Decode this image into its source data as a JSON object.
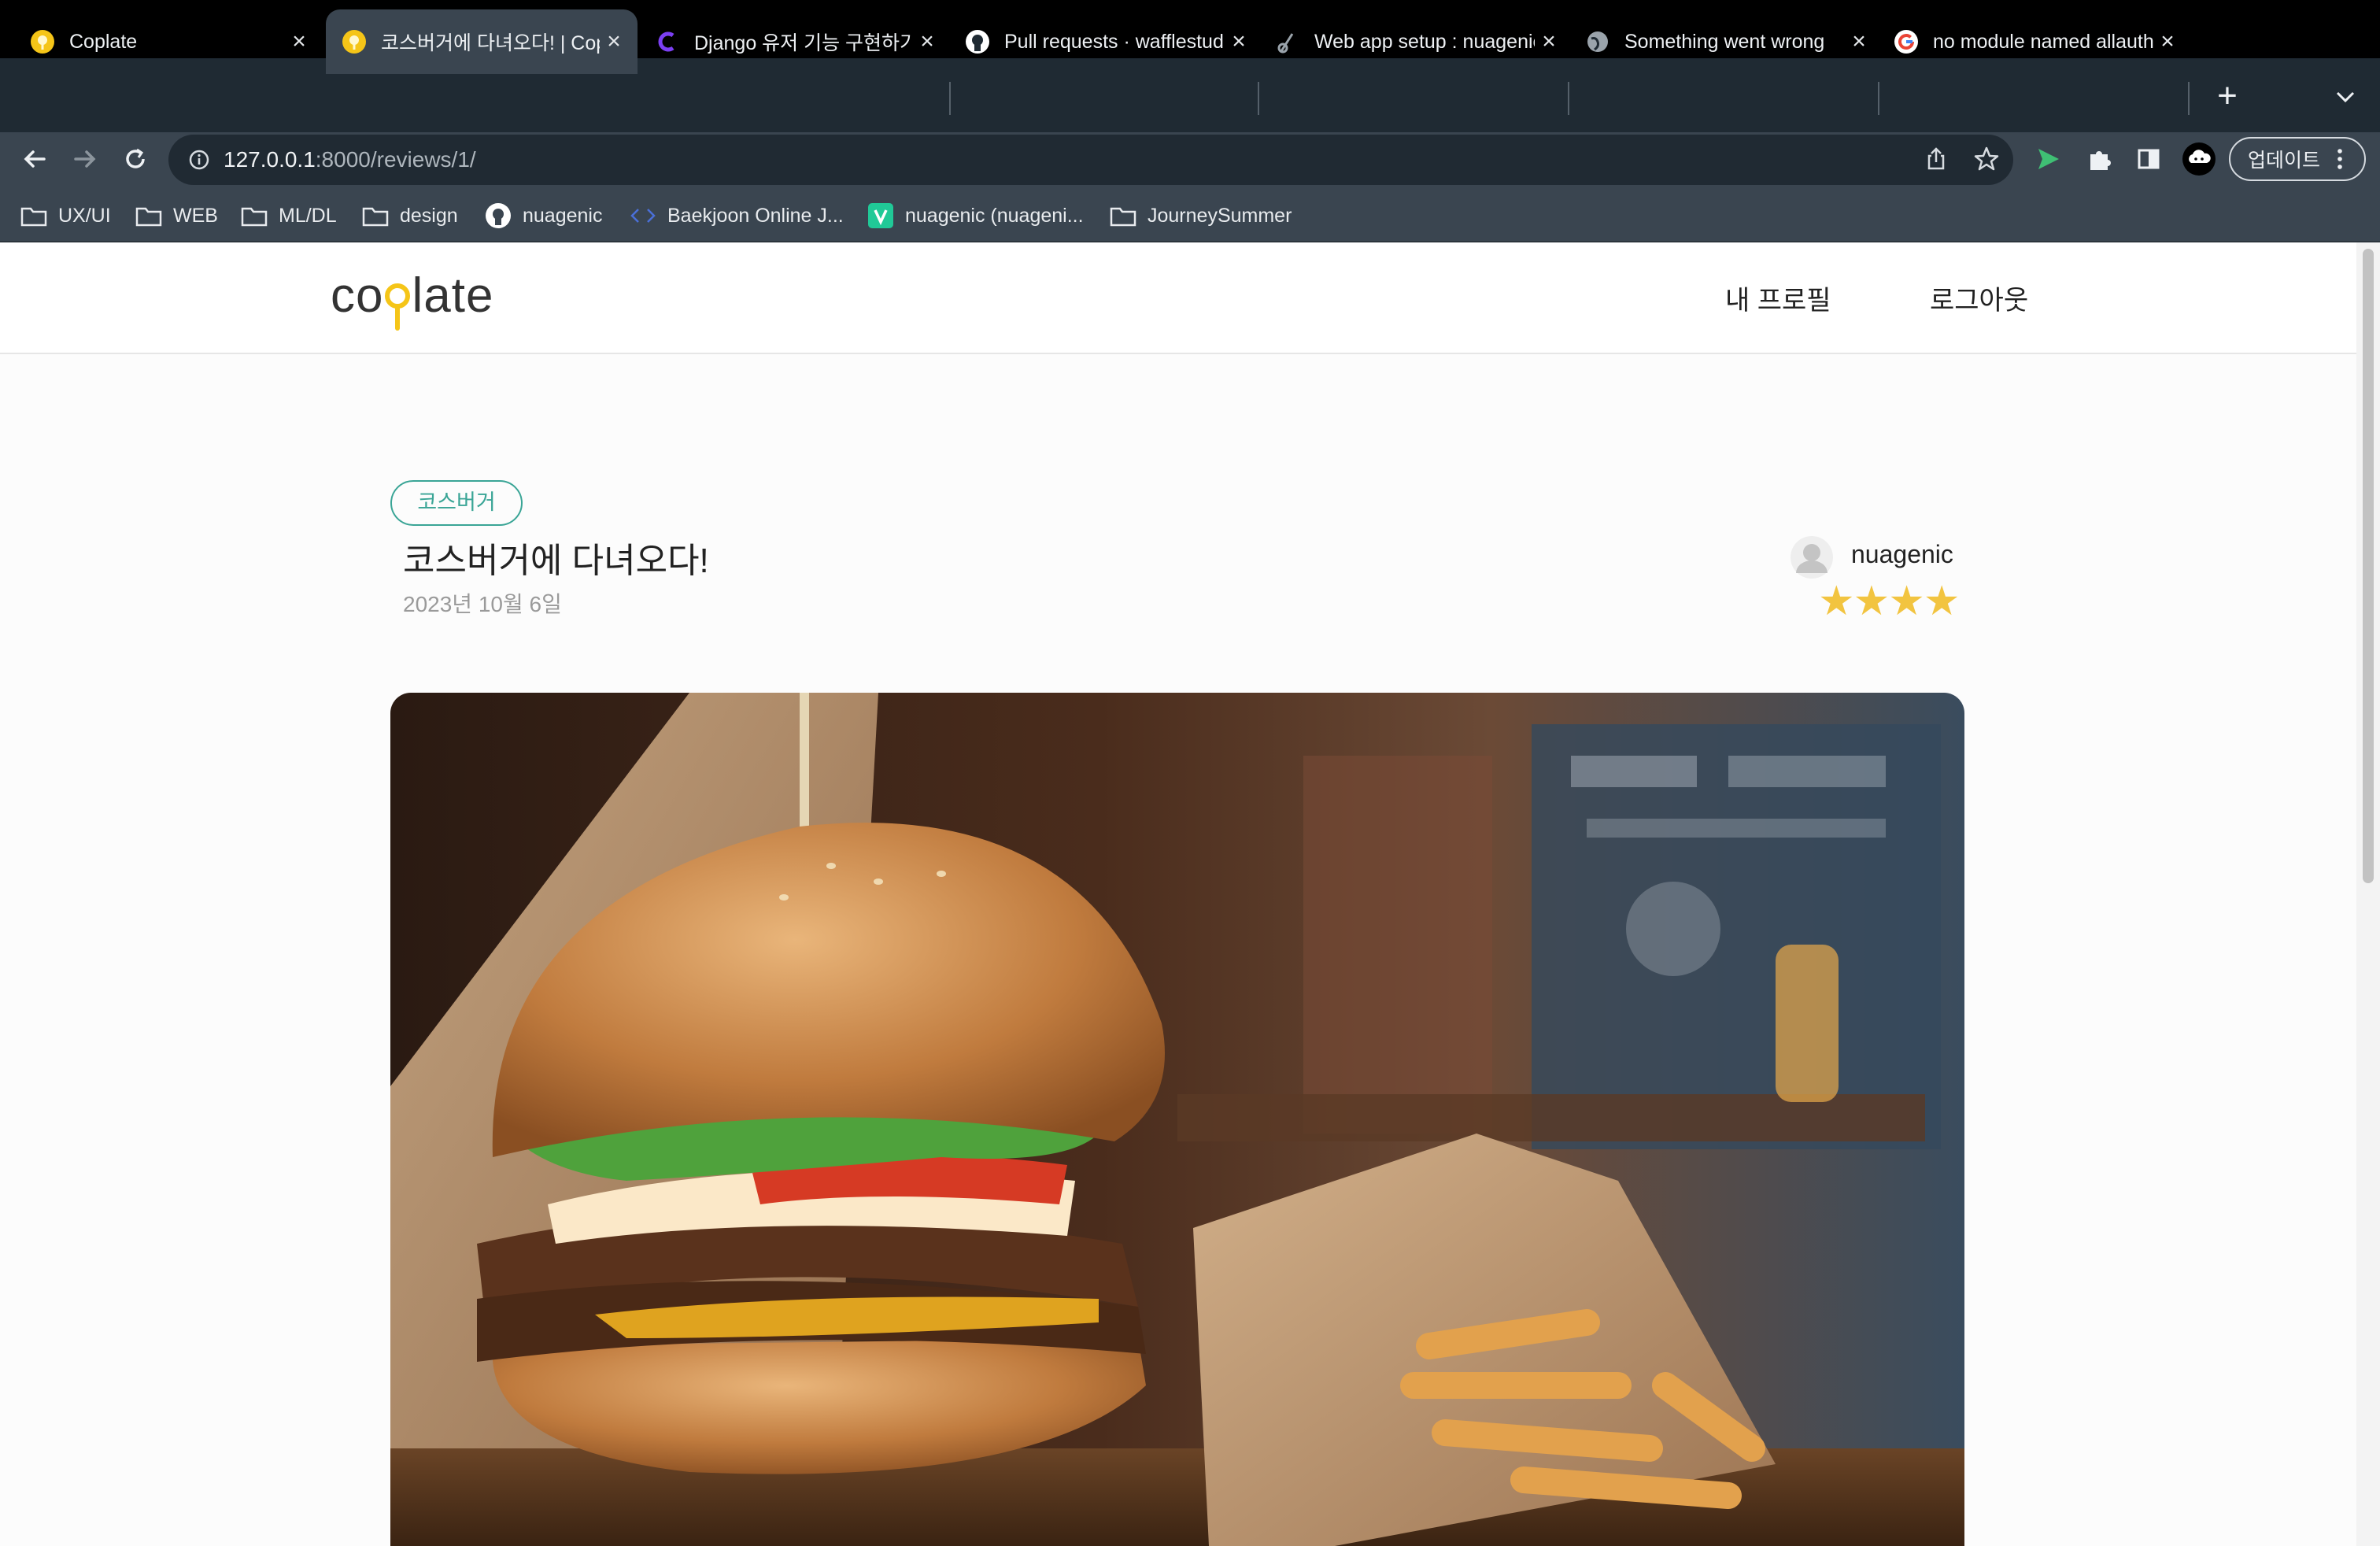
{
  "browser": {
    "tabs": [
      {
        "title": "Coplate",
        "favicon": "coplate-favicon-icon",
        "active": false
      },
      {
        "title": "코스버거에 다녀오다! | Coplate",
        "favicon": "coplate-favicon-icon",
        "active": true
      },
      {
        "title": "Django 유저 기능 구현하기",
        "favicon": "codeit-favicon-icon",
        "active": false
      },
      {
        "title": "Pull requests · wafflestudio",
        "favicon": "github-icon",
        "active": false
      },
      {
        "title": "Web app setup : nuagenic",
        "favicon": "pythonanywhere-icon",
        "active": false
      },
      {
        "title": "Something went wrong",
        "favicon": "globe-icon",
        "active": false
      },
      {
        "title": "no module named allauth",
        "favicon": "google-icon",
        "active": false
      }
    ],
    "new_tab_label": "+",
    "url_host": "127.0.0.1",
    "url_rest": ":8000/reviews/1/",
    "update_label": "업데이트",
    "bookmarks": [
      {
        "label": "UX/UI",
        "icon": "folder-icon"
      },
      {
        "label": "WEB",
        "icon": "folder-icon"
      },
      {
        "label": "ML/DL",
        "icon": "folder-icon"
      },
      {
        "label": "design",
        "icon": "folder-icon"
      },
      {
        "label": "nuagenic",
        "icon": "github-icon"
      },
      {
        "label": "Baekjoon Online J...",
        "icon": "code-icon"
      },
      {
        "label": "nuagenic (nuageni...",
        "icon": "v-icon"
      },
      {
        "label": "JourneySummer",
        "icon": "folder-icon"
      }
    ]
  },
  "site": {
    "logo_left": "co",
    "logo_right": "late",
    "nav": {
      "profile": "내 프로필",
      "logout": "로그아웃"
    }
  },
  "review": {
    "tag": "코스버거",
    "title": "코스버거에 다녀오다!",
    "date": "2023년 10월 6일",
    "author": "nuagenic",
    "rating": 4,
    "stars": "★★★★"
  },
  "colors": {
    "accent_teal": "#3aa596",
    "star_gold": "#f2c440",
    "logo_yellow": "#f5c518"
  }
}
